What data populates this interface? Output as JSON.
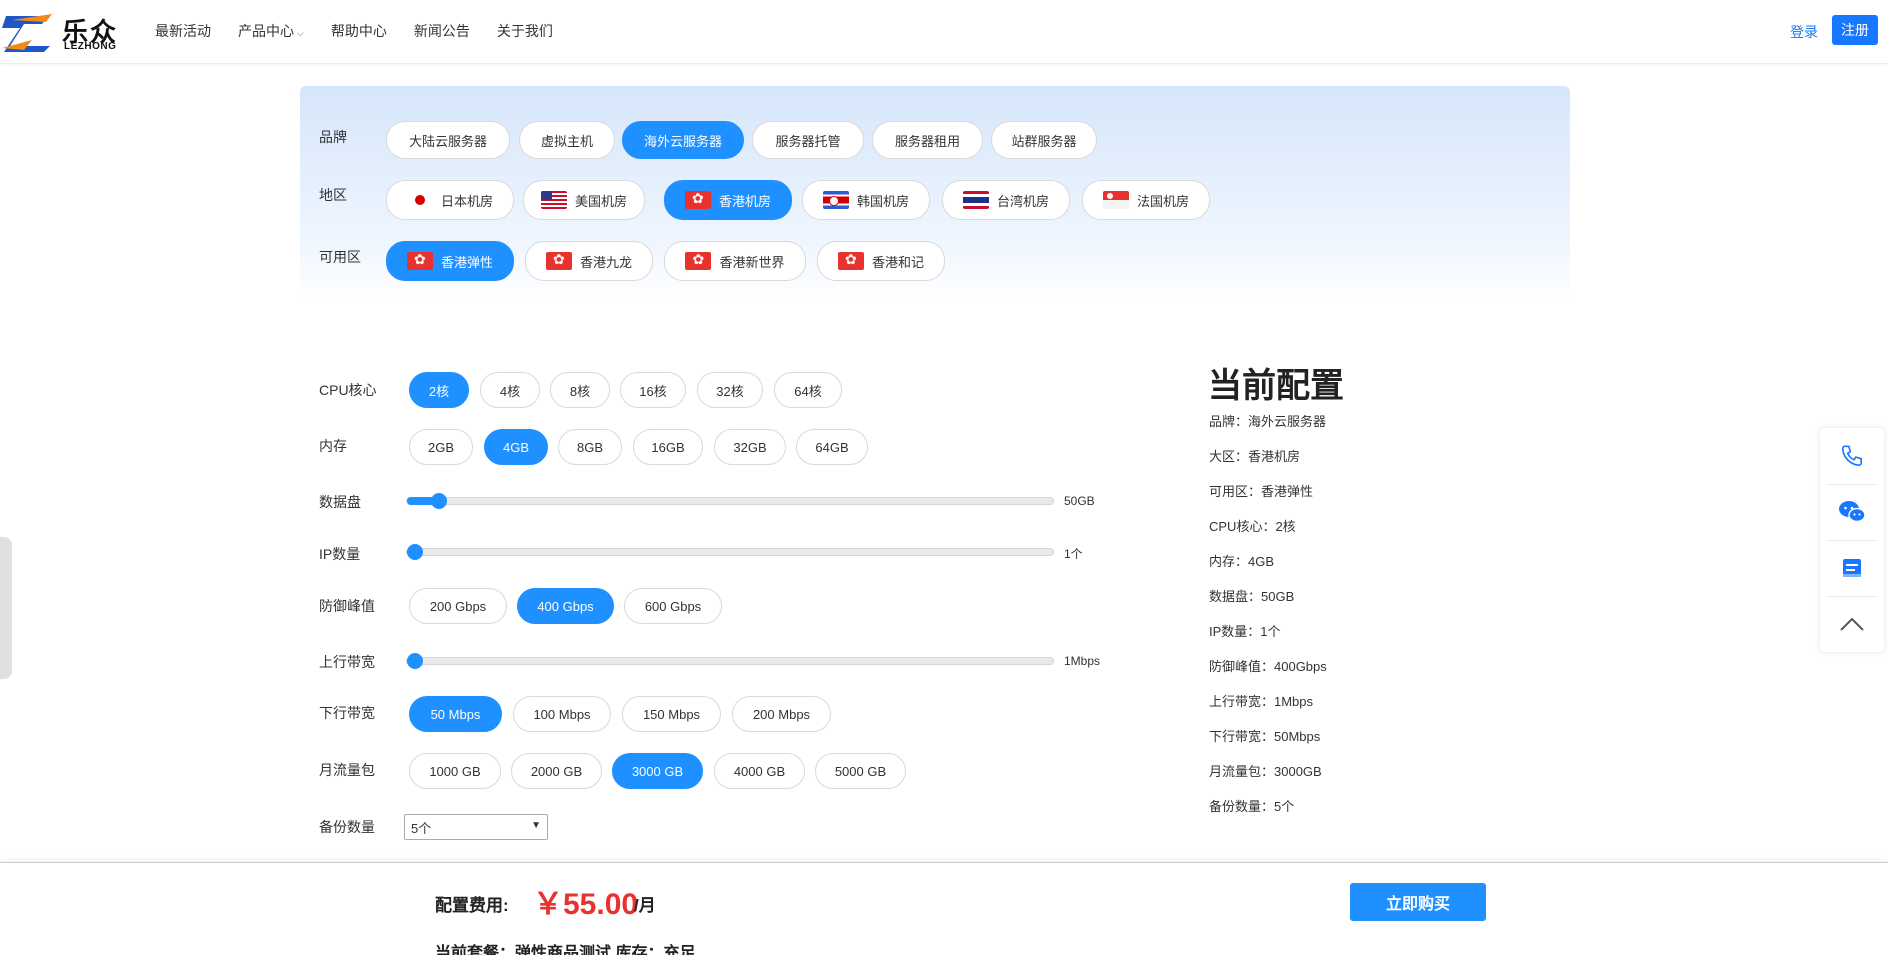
{
  "header": {
    "logo_cn": "乐众",
    "logo_en": "LEZHONG",
    "nav": [
      "最新活动",
      "产品中心",
      "帮助中心",
      "新闻公告",
      "关于我们"
    ],
    "login": "登录",
    "register": "注册"
  },
  "filters": {
    "brand": {
      "label": "品牌",
      "options": [
        "大陆云服务器",
        "虚拟主机",
        "海外云服务器",
        "服务器托管",
        "服务器租用",
        "站群服务器"
      ],
      "selected": "海外云服务器"
    },
    "region": {
      "label": "地区",
      "options": [
        {
          "label": "日本机房",
          "flag": "jp-flag-icon"
        },
        {
          "label": "美国机房",
          "flag": "us-flag-icon"
        },
        {
          "label": "香港机房",
          "flag": "hk-flag-icon"
        },
        {
          "label": "韩国机房",
          "flag": "kr-flag-icon"
        },
        {
          "label": "台湾机房",
          "flag": "th-flag-icon"
        },
        {
          "label": "法国机房",
          "flag": "sg-flag-icon"
        }
      ],
      "selected": "香港机房"
    },
    "zone": {
      "label": "可用区",
      "options": [
        "香港弹性",
        "香港九龙",
        "香港新世界",
        "香港和记"
      ],
      "selected": "香港弹性"
    }
  },
  "config": {
    "cpu": {
      "label": "CPU核心",
      "options": [
        "2核",
        "4核",
        "8核",
        "16核",
        "32核",
        "64核"
      ],
      "selected": "2核"
    },
    "memory": {
      "label": "内存",
      "options": [
        "2GB",
        "4GB",
        "8GB",
        "16GB",
        "32GB",
        "64GB"
      ],
      "selected": "4GB"
    },
    "disk": {
      "label": "数据盘",
      "value_text": "50GB",
      "fraction": 0.05
    },
    "ip": {
      "label": "IP数量",
      "value_text": "1个",
      "fraction": 0.0
    },
    "defense": {
      "label": "防御峰值",
      "options": [
        "200 Gbps",
        "400 Gbps",
        "600 Gbps"
      ],
      "selected": "400 Gbps"
    },
    "upload": {
      "label": "上行带宽",
      "value_text": "1Mbps",
      "fraction": 0.0
    },
    "download": {
      "label": "下行带宽",
      "options": [
        "50 Mbps",
        "100 Mbps",
        "150 Mbps",
        "200 Mbps"
      ],
      "selected": "50 Mbps"
    },
    "traffic": {
      "label": "月流量包",
      "options": [
        "1000 GB",
        "2000 GB",
        "3000 GB",
        "4000 GB",
        "5000 GB"
      ],
      "selected": "3000 GB"
    },
    "backup": {
      "label": "备份数量",
      "value": "5个"
    }
  },
  "summary": {
    "title": "当前配置",
    "lines": [
      "品牌：海外云服务器",
      "大区：香港机房",
      "可用区：香港弹性",
      "CPU核心：2核",
      "内存：4GB",
      "数据盘：50GB",
      "IP数量：1个",
      "防御峰值：400Gbps",
      "上行带宽：1Mbps",
      "下行带宽：50Mbps",
      "月流量包：3000GB",
      "备份数量：5个"
    ]
  },
  "bottom": {
    "fee_label": "配置费用:",
    "price": "￥55.00",
    "unit": "/月",
    "buy": "立即购买",
    "package": "当前套餐：弹性商品测试 库存：充足"
  },
  "colors": {
    "accent": "#1e90ff",
    "brand_blue": "#1677ff",
    "price_red": "#e8322d"
  }
}
